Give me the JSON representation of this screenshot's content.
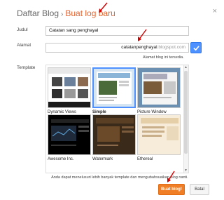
{
  "dialog": {
    "breadcrumb_parent": "Daftar Blog",
    "breadcrumb_sep": "›",
    "breadcrumb_current": "Buat log baru",
    "close_glyph": "×"
  },
  "form": {
    "title_label": "Judul",
    "title_value": "Catatan sang penghayal",
    "address_label": "Alamat",
    "address_value": "catatanpenghayal",
    "address_suffix": ".blogspot.com",
    "availability": "Alamat blog ini tersedia.",
    "template_label": "Template"
  },
  "templates": [
    {
      "name": "Dynamic Views"
    },
    {
      "name": "Simple"
    },
    {
      "name": "Picture Window"
    },
    {
      "name": "Awesome Inc."
    },
    {
      "name": "Watermark"
    },
    {
      "name": "Ethereal"
    }
  ],
  "footer": {
    "description": "Anda dapat menelusuri lebih banyak template dan mengubahsuaikan blog nanti.",
    "create_button": "Buat blog!",
    "cancel_button": "Batal"
  },
  "colors": {
    "accent": "#e8622c",
    "primary_button": "#f07e27",
    "check_button": "#4d90fe",
    "annotation_arrow": "#cc0000"
  }
}
